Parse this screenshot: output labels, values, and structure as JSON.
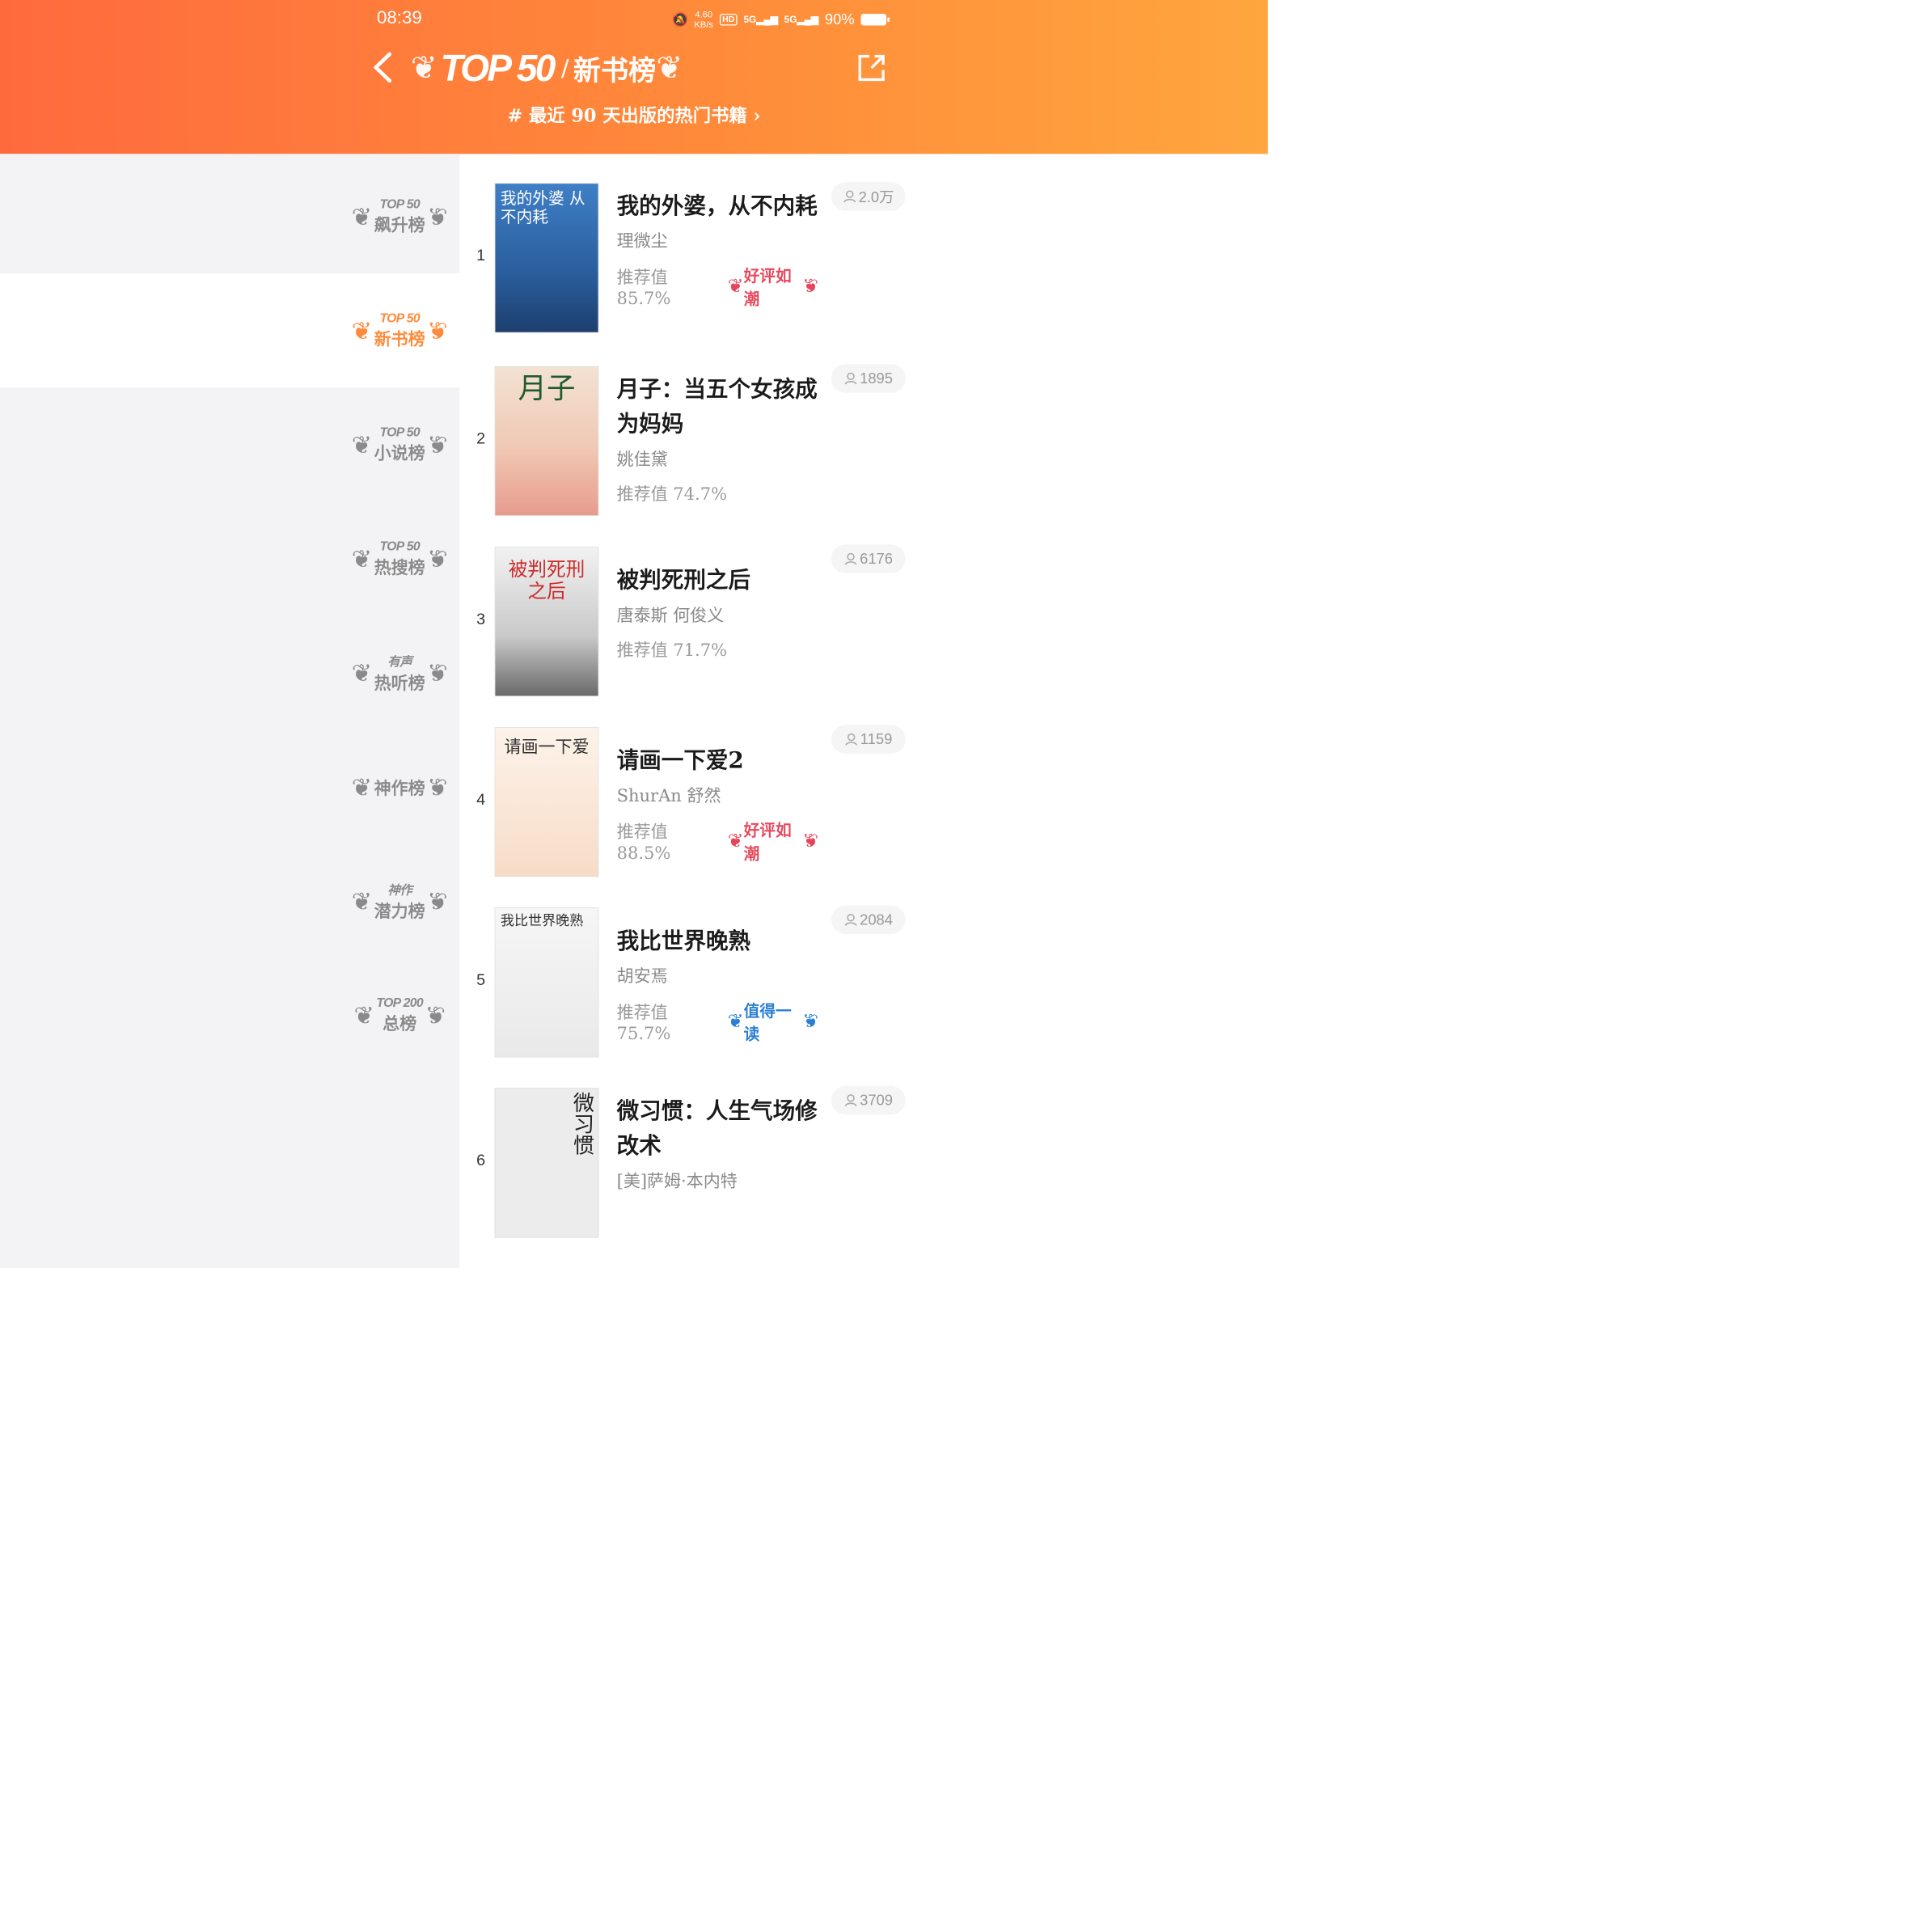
{
  "status": {
    "time": "08:39",
    "net_speed": "4.60",
    "net_unit": "KB/s",
    "hd": "HD",
    "sig1": "5G",
    "sig2": "5G",
    "battery": "90%"
  },
  "header": {
    "title_brand": "TOP 50",
    "title_sep": "/",
    "title_name": "新书榜",
    "subtitle": "# 最近 90 天出版的热门书籍 ›"
  },
  "sidebar": {
    "items": [
      {
        "line1": "TOP 50",
        "line2": "飙升榜"
      },
      {
        "line1": "TOP 50",
        "line2": "新书榜"
      },
      {
        "line1": "TOP 50",
        "line2": "小说榜"
      },
      {
        "line1": "TOP 50",
        "line2": "热搜榜"
      },
      {
        "line1": "有声",
        "line2": "热听榜"
      },
      {
        "line1": "",
        "line2": "神作榜"
      },
      {
        "line1": "神作",
        "line2": "潜力榜"
      },
      {
        "line1": "TOP 200",
        "line2": "总榜"
      }
    ]
  },
  "books": [
    {
      "rank": "1",
      "title": "我的外婆，从不内耗",
      "author": "理微尘",
      "rec": "推荐值 85.7%",
      "badge": "好评如潮",
      "readers": "2.0万",
      "cover_text": "我的外婆 从不内耗"
    },
    {
      "rank": "2",
      "title": "月子：当五个女孩成为妈妈",
      "author": "姚佳黛",
      "rec": "推荐值 74.7%",
      "badge": "",
      "readers": "1895",
      "cover_text": "月子"
    },
    {
      "rank": "3",
      "title": "被判死刑之后",
      "author": "唐泰斯 何俊义",
      "rec": "推荐值 71.7%",
      "badge": "",
      "readers": "6176",
      "cover_text": "被判死刑 之后"
    },
    {
      "rank": "4",
      "title": "请画一下爱2",
      "author": "ShurAn 舒然",
      "rec": "推荐值 88.5%",
      "badge": "好评如潮",
      "readers": "1159",
      "cover_text": "请画一下爱"
    },
    {
      "rank": "5",
      "title": "我比世界晚熟",
      "author": "胡安焉",
      "rec": "推荐值 75.7%",
      "badge": "值得一读",
      "readers": "2084",
      "cover_text": "我比世界晚熟"
    },
    {
      "rank": "6",
      "title": "微习惯：人生气场修改术",
      "author": "[美]萨姆·本内特",
      "rec": "",
      "badge": "",
      "readers": "3709",
      "cover_text": "微习惯"
    }
  ],
  "colors": {
    "header_start": "#ff6a3d",
    "header_end": "#ffa63e",
    "active": "#ff8a3a",
    "badge_red": "#e8455a",
    "badge_blue": "#2a7fd4"
  }
}
